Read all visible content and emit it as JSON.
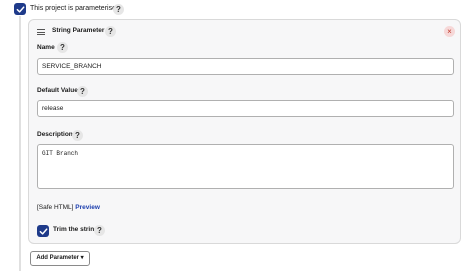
{
  "parameterised": {
    "label": "This project is parameterised",
    "checked": true,
    "help": "?"
  },
  "string_parameter": {
    "title": "String Parameter",
    "help": "?",
    "close": "×",
    "name": {
      "label": "Name",
      "help": "?",
      "value": "SERVICE_BRANCH"
    },
    "default_value": {
      "label": "Default Value",
      "help": "?",
      "value": "release"
    },
    "description": {
      "label": "Description",
      "help": "?",
      "value": "GIT Branch"
    },
    "safe_html": {
      "prefix": "[Safe HTML]",
      "preview": "Preview"
    },
    "trim": {
      "label": "Trim the string",
      "help": "?",
      "checked": true
    }
  },
  "add_parameter": {
    "label": "Add Parameter",
    "caret": "▾"
  },
  "colors": {
    "accent": "#1e3a8a",
    "link": "#1e40af",
    "close": "#c0392b"
  }
}
